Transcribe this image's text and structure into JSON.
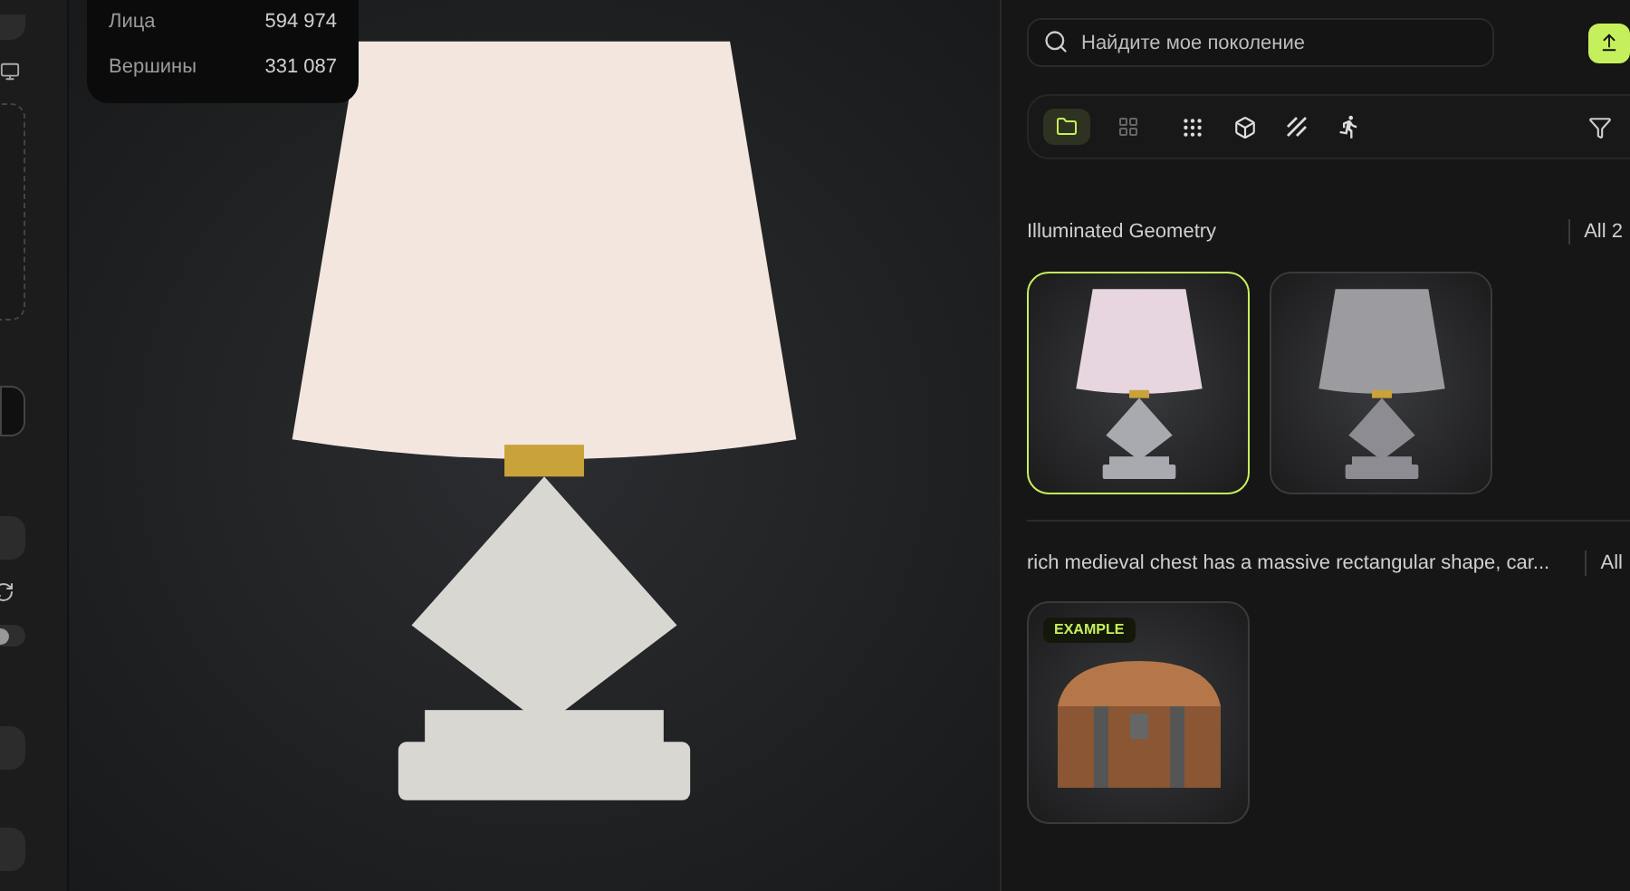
{
  "stats": [
    {
      "label": "Лица",
      "value": "594 974"
    },
    {
      "label": "Вершины",
      "value": "331 087"
    }
  ],
  "search": {
    "placeholder": "Найдите мое поколение"
  },
  "toggle": {
    "on": false
  },
  "view_tabs": [
    {
      "kind": "folder",
      "selected": true
    },
    {
      "kind": "grid",
      "selected": false
    }
  ],
  "groups": [
    {
      "title": "Illuminated Geometry",
      "count": "All 2",
      "items": [
        {
          "kind": "lamp",
          "selected": true
        },
        {
          "kind": "silverlamp",
          "selected": false
        }
      ]
    },
    {
      "title": "rich medieval chest has a massive rectangular shape, car...",
      "count": "All",
      "items": [
        {
          "kind": "chest",
          "selected": false,
          "badge": "EXAMPLE"
        }
      ]
    }
  ]
}
